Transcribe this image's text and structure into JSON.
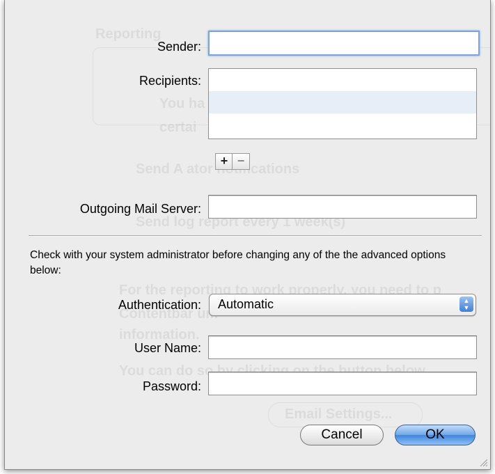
{
  "form": {
    "sender_label": "Sender:",
    "sender_value": "",
    "recipients_label": "Recipients:",
    "add_symbol": "+",
    "remove_symbol": "−",
    "outgoing_label": "Outgoing Mail Server:",
    "outgoing_value": ""
  },
  "advanced": {
    "note": "Check with your system administrator before changing any of the the advanced options below:",
    "auth_label": "Authentication:",
    "auth_value": "Automatic",
    "username_label": "User Name:",
    "username_value": "",
    "password_label": "Password:",
    "password_value": ""
  },
  "buttons": {
    "cancel": "Cancel",
    "ok": "OK"
  },
  "background": {
    "heading": "Reporting",
    "line1": "You ha",
    "line2": "certai",
    "notify": "Send A          ator notifications",
    "log": "Send log report every       1      week(s)",
    "para1": "For the reporting to work properly, you need to p",
    "para2": "Contentbar           um",
    "para3": "information.",
    "para4": "You can do so by clicking on the button below",
    "email_btn": "Email Settings..."
  },
  "colors": {
    "sheet_bg": "#ececec",
    "focus_ring": "#7ea3d9",
    "selected_row": "#e8eef8",
    "default_button": "#3f86de"
  },
  "icons": {
    "popup_arrows": "up-down-arrows-icon",
    "resize": "resize-grip-icon"
  }
}
